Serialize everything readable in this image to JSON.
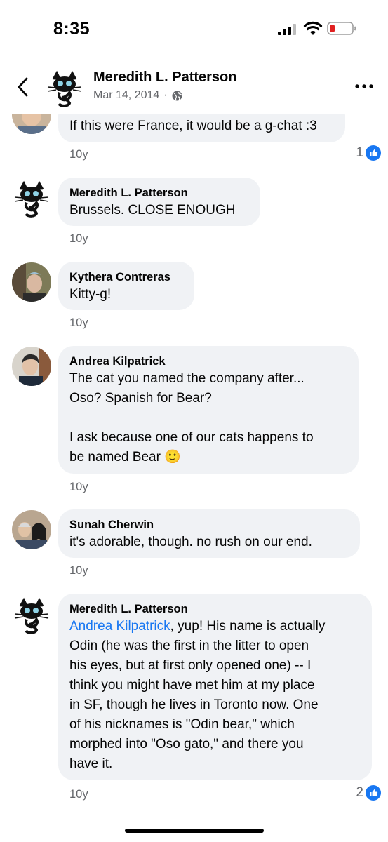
{
  "status_bar": {
    "time": "8:35"
  },
  "header": {
    "name": "Meredith L. Patterson",
    "date": "Mar 14, 2014",
    "separator": "·"
  },
  "comments": [
    {
      "author": "",
      "text": "If this were France, it would be a g-chat :3",
      "age": "10y",
      "reactions": "1"
    },
    {
      "author": "Meredith L. Patterson",
      "text": "Brussels. CLOSE ENOUGH",
      "age": "10y"
    },
    {
      "author": "Kythera Contreras",
      "text": "Kitty-g!",
      "age": "10y"
    },
    {
      "author": "Andrea Kilpatrick",
      "text": "The cat you named the company after...\nOso? Spanish for Bear?\n\nI ask because one of our cats happens to\nbe named Bear",
      "emoji": "🙂",
      "age": "10y"
    },
    {
      "author": "Sunah Cherwin",
      "text": "it's adorable, though. no rush on our end.",
      "age": "10y"
    },
    {
      "author": "Meredith L. Patterson",
      "mention": "Andrea Kilpatrick",
      "text": ", yup! His name is actually\nOdin (he was the first in the litter to open\nhis eyes, but at first only opened one) -- I\nthink you might have met him at my place\nin SF, though he lives in Toronto now. One\nof his nicknames is \"Odin bear,\" which\nmorphed into \"Oso gato,\" and there you\nhave it.",
      "age": "10y",
      "reactions": "2"
    }
  ],
  "colors": {
    "link": "#1877f2",
    "bubble": "#f0f2f5",
    "meta": "#65676b",
    "battery_low": "#e02020"
  },
  "icons": [
    "back-arrow-icon",
    "globe-icon",
    "more-icon",
    "like-icon",
    "signal-icon",
    "wifi-icon",
    "battery-icon"
  ]
}
